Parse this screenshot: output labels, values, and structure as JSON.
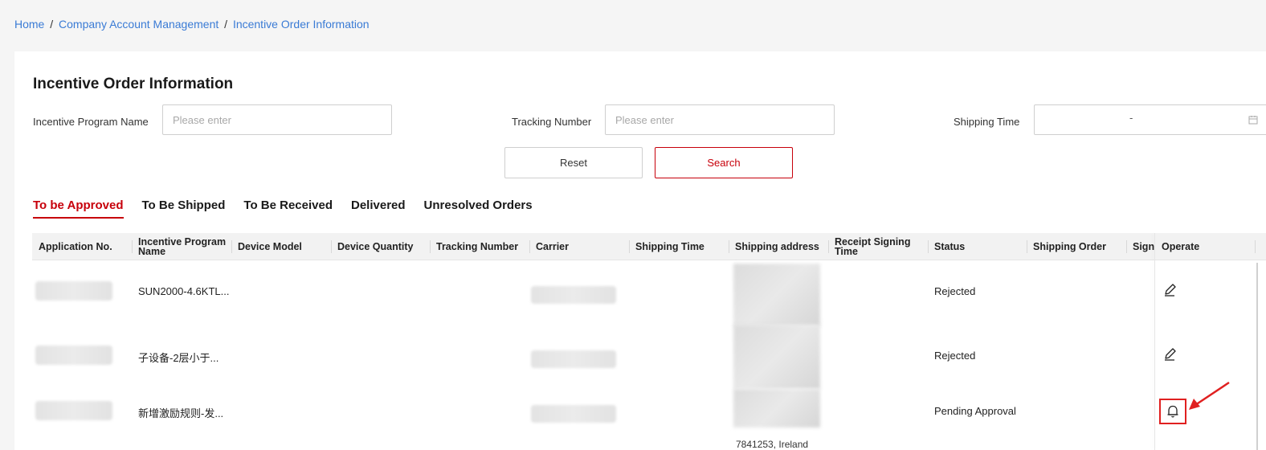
{
  "breadcrumb": {
    "home": "Home",
    "section": "Company Account Management",
    "page": "Incentive Order Information",
    "separator": "/"
  },
  "page_title": "Incentive Order Information",
  "filters": {
    "program_name_label": "Incentive Program Name",
    "program_name_placeholder": "Please enter",
    "tracking_label": "Tracking Number",
    "tracking_placeholder": "Please enter",
    "shipping_time_label": "Shipping Time",
    "date_separator": "-"
  },
  "buttons": {
    "reset": "Reset",
    "search": "Search"
  },
  "tabs": [
    {
      "label": "To be Approved",
      "active": true
    },
    {
      "label": "To Be Shipped",
      "active": false
    },
    {
      "label": "To Be Received",
      "active": false
    },
    {
      "label": "Delivered",
      "active": false
    },
    {
      "label": "Unresolved Orders",
      "active": false
    }
  ],
  "table": {
    "columns": [
      "Application No.",
      "Incentive Program Name",
      "Device Model",
      "Device Quantity",
      "Tracking Number",
      "Carrier",
      "Shipping Time",
      "Shipping address",
      "Receipt Signing Time",
      "Status",
      "Shipping Order",
      "Signi",
      "Operate"
    ],
    "rows": [
      {
        "program": "SUN2000-4.6KTL...",
        "status": "Rejected",
        "operate_icon": "edit-icon"
      },
      {
        "program": "子设备-2层小于...",
        "status": "Rejected",
        "operate_icon": "edit-icon"
      },
      {
        "program": "新增激励规则-发...",
        "status": "Pending Approval",
        "operate_icon": "bell-icon"
      }
    ],
    "address_fragment": "7841253, Ireland"
  },
  "colors": {
    "accent": "#c7000b",
    "link": "#3a7bd5",
    "annotation": "#e02020"
  }
}
